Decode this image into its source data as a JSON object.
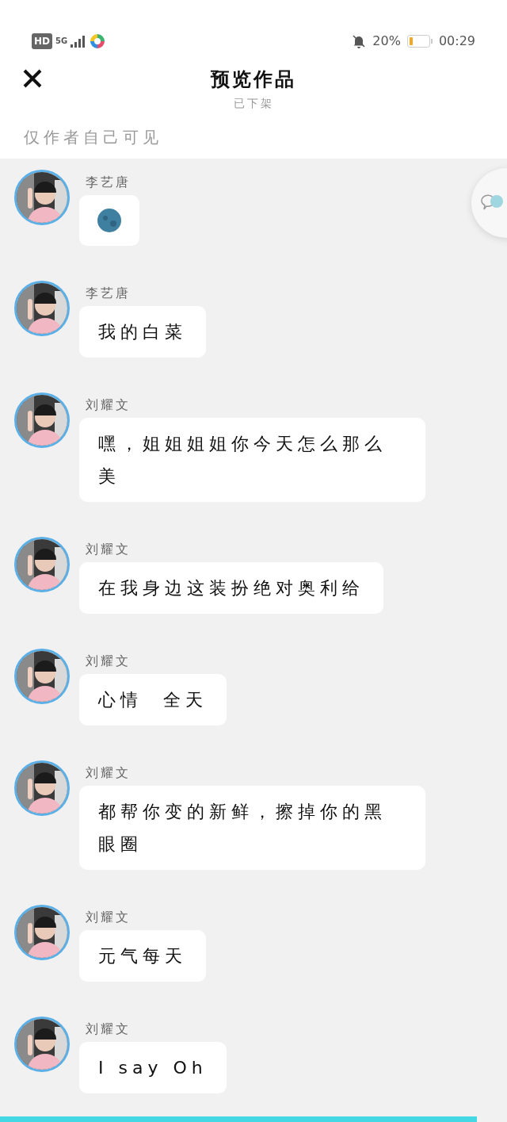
{
  "status_bar": {
    "hd": "HD",
    "network": "5G",
    "battery": "20%",
    "time": "00:29"
  },
  "header": {
    "title": "预览作品",
    "subtitle": "已下架"
  },
  "visibility_note": "仅作者自己可见",
  "messages": [
    {
      "author": "李艺唐",
      "kind": "emoji"
    },
    {
      "author": "李艺唐",
      "kind": "text",
      "text": "我的白菜"
    },
    {
      "author": "刘耀文",
      "kind": "text",
      "text": "嘿，姐姐姐姐你今天怎么那么美"
    },
    {
      "author": "刘耀文",
      "kind": "text",
      "text": "在我身边这装扮绝对奥利给"
    },
    {
      "author": "刘耀文",
      "kind": "text",
      "text": "心情  全天"
    },
    {
      "author": "刘耀文",
      "kind": "text",
      "text": "都帮你变的新鲜，擦掉你的黑眼圈"
    },
    {
      "author": "刘耀文",
      "kind": "text",
      "text": "元气每天"
    },
    {
      "author": "刘耀文",
      "kind": "text",
      "text": "I say Oh"
    }
  ],
  "playback": {
    "level": 0.94
  }
}
